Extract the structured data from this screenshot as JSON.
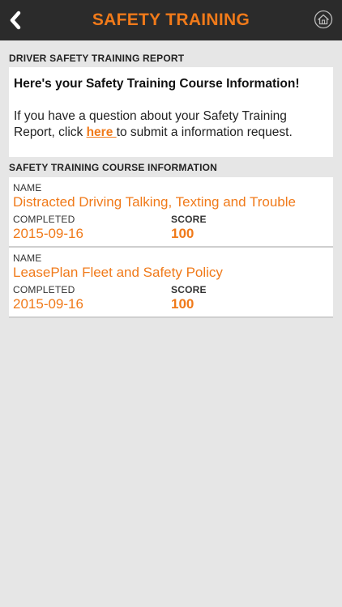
{
  "header": {
    "title": "SAFETY TRAINING"
  },
  "report": {
    "section_title": "DRIVER SAFETY TRAINING REPORT",
    "heading": "Here's your Safety Training Course Information!",
    "text_before_link": "If you have a question about your Safety Training Report, click ",
    "link_text": "here ",
    "text_after_link": " to submit a information request."
  },
  "courses_section": {
    "title": "SAFETY TRAINING COURSE INFORMATION"
  },
  "courses": [
    {
      "name_label": "NAME",
      "name": "Distracted Driving Talking, Texting and Trouble",
      "completed_label": "COMPLETED",
      "completed": "2015-09-16",
      "score_label": "SCORE",
      "score": "100"
    },
    {
      "name_label": "NAME",
      "name": "LeasePlan Fleet and Safety Policy",
      "completed_label": "COMPLETED",
      "completed": "2015-09-16",
      "score_label": "SCORE",
      "score": "100"
    }
  ],
  "colors": {
    "accent": "#f07a1a",
    "navbar": "#2b2b2b",
    "background": "#e6e6e6"
  },
  "icons": {
    "back": "chevron-left-icon",
    "home": "home-icon"
  }
}
